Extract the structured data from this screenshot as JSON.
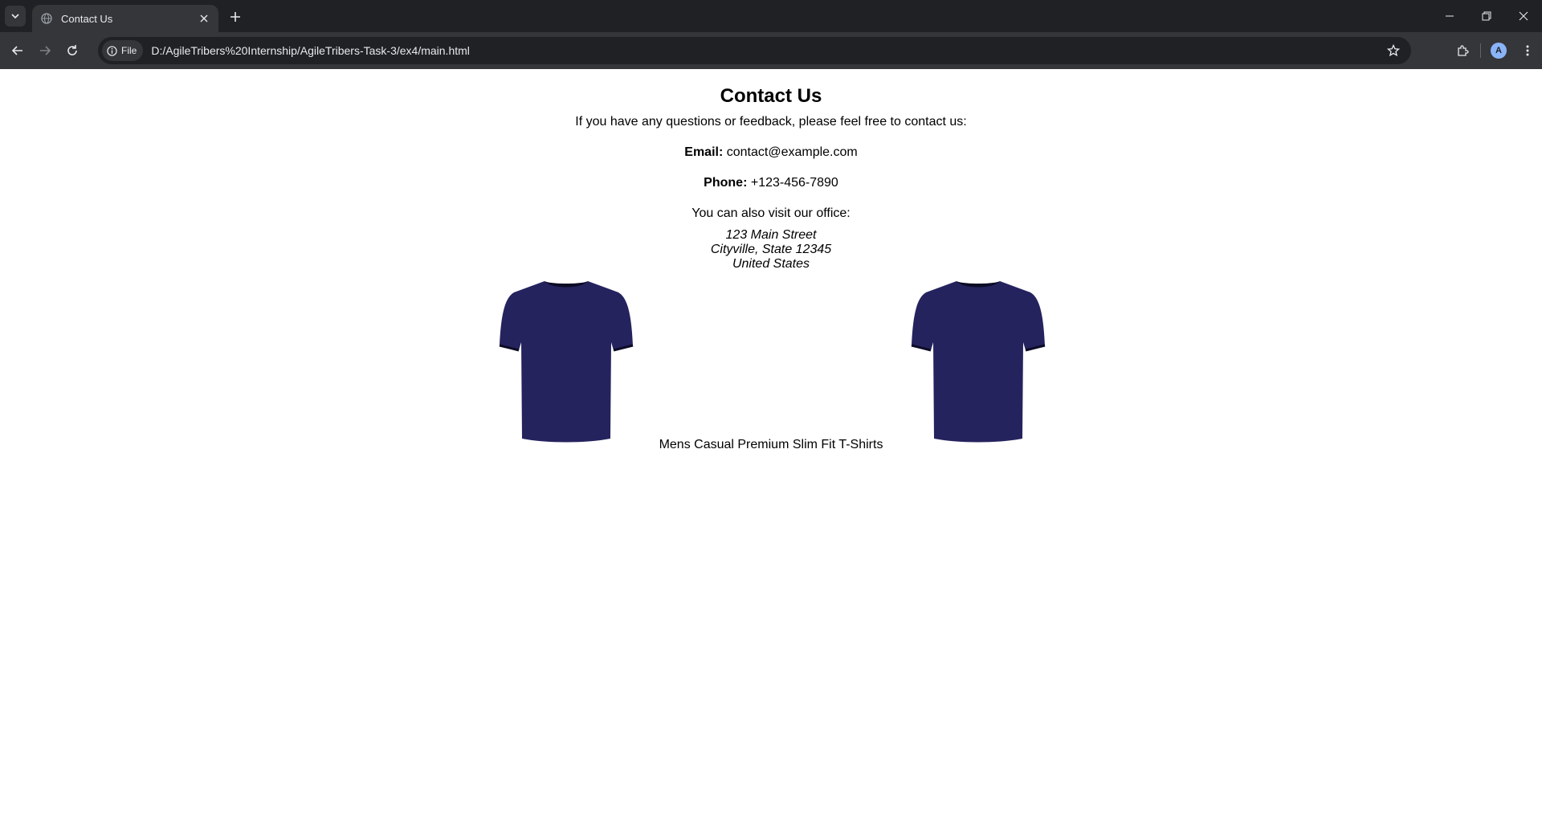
{
  "browser": {
    "tab_title": "Contact Us",
    "chip_label": "File",
    "url": "D:/AgileTribers%20Internship/AgileTribers-Task-3/ex4/main.html",
    "profile_initial": "A",
    "icons": [
      "tab-search-icon",
      "globe-icon",
      "close-icon",
      "plus-icon",
      "minimize-icon",
      "restore-icon",
      "close-window-icon",
      "back-icon",
      "forward-icon",
      "reload-icon",
      "info-icon",
      "star-icon",
      "extensions-icon",
      "menu-icon"
    ]
  },
  "page": {
    "heading": "Contact Us",
    "intro": "If you have any questions or feedback, please feel free to contact us:",
    "email_label": "Email:",
    "email_value": "contact@example.com",
    "phone_label": "Phone:",
    "phone_value": "+123-456-7890",
    "office_text": "You can also visit our office:",
    "address": {
      "line1": "123 Main Street",
      "line2": "Cityville, State 12345",
      "line3": "United States"
    },
    "product_caption": "Mens Casual Premium Slim Fit T-Shirts",
    "shirt_color": "#25235e"
  }
}
